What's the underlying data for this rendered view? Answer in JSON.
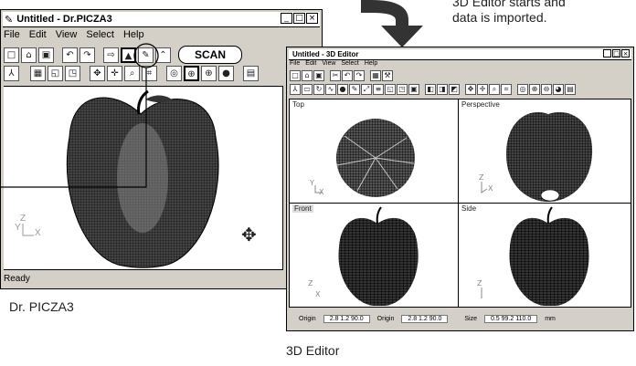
{
  "callout": {
    "line1": "3D Editor starts and",
    "line2": "data is imported."
  },
  "picza": {
    "title": "Untitled - Dr.PICZA3",
    "menu": [
      "File",
      "Edit",
      "View",
      "Select",
      "Help"
    ],
    "scan_label": "SCAN",
    "status": "Ready",
    "caption": "Dr. PICZA3",
    "axis_z": "Z",
    "axis_y": "Y",
    "axis_x": "X"
  },
  "editor": {
    "title": "Untitled - 3D Editor",
    "menu": [
      "File",
      "Edit",
      "View",
      "Select",
      "Help"
    ],
    "views": {
      "top": "Top",
      "perspective": "Perspective",
      "front": "Front",
      "side": "Side"
    },
    "status_fields": [
      {
        "label": "Origin",
        "value": "2.8 1.2 90.0"
      },
      {
        "label": "Origin",
        "value": "2.8 1.2 90.0"
      },
      {
        "label": "Size",
        "value": "0.5 99.2 110.0"
      }
    ],
    "status_unit": "mm",
    "caption": "3D Editor"
  },
  "colors": {
    "mesh": "#111111",
    "chrome": "#d4d0c8",
    "highlight_circle": "#000000"
  }
}
